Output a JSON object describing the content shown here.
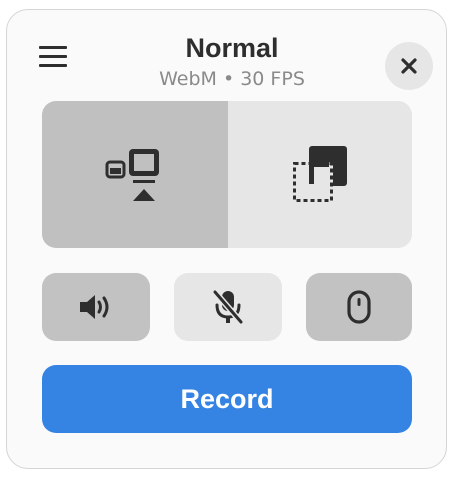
{
  "header": {
    "title": "Normal",
    "subtitle": "WebM • 30 FPS",
    "menu_icon": "hamburger-menu-icon",
    "close_icon": "close-icon"
  },
  "capture_source": {
    "options": [
      {
        "icon": "window-capture-icon",
        "selected": true
      },
      {
        "icon": "selection-capture-icon",
        "selected": false
      }
    ]
  },
  "toggles": [
    {
      "icon": "speaker-icon",
      "active": true
    },
    {
      "icon": "microphone-muted-icon",
      "active": false
    },
    {
      "icon": "mouse-pointer-icon",
      "active": true
    }
  ],
  "record": {
    "label": "Record"
  },
  "colors": {
    "accent": "#3584e4",
    "text": "#2e2e2e",
    "subtitle": "#8a8a8a",
    "active_button": "#c0c0c0",
    "inactive_button": "#e6e6e6"
  }
}
